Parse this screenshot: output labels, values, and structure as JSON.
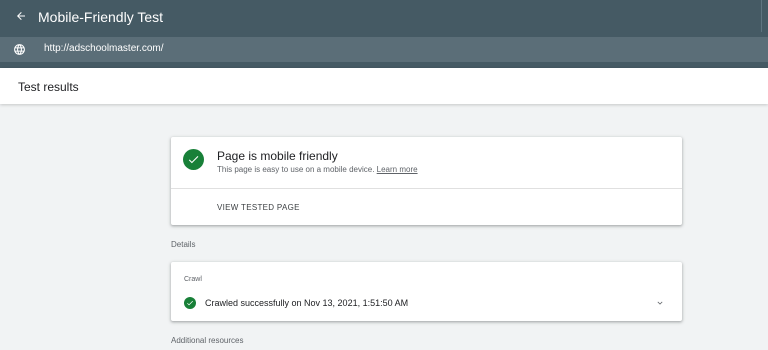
{
  "header": {
    "title": "Mobile-Friendly Test",
    "back_icon": "arrow-back-icon"
  },
  "url_bar": {
    "icon": "globe-icon",
    "value": "http://adschoolmaster.com/"
  },
  "results": {
    "title": "Test results"
  },
  "verdict": {
    "icon": "check-circle-icon",
    "title": "Page is mobile friendly",
    "subtitle": "This page is easy to use on a mobile device.",
    "learn_more": "Learn more",
    "view_button": "VIEW TESTED PAGE"
  },
  "details": {
    "label": "Details",
    "crawl_title": "Crawl",
    "crawl_status": "Crawled successfully on Nov 13, 2021, 1:51:50 AM",
    "expand_icon": "chevron-down-icon"
  },
  "additional": {
    "label": "Additional resources"
  },
  "colors": {
    "header_bg": "#455a64",
    "url_bar_bg": "#5b6e78",
    "success_green": "#188038",
    "page_bg": "#f1f3f4"
  }
}
